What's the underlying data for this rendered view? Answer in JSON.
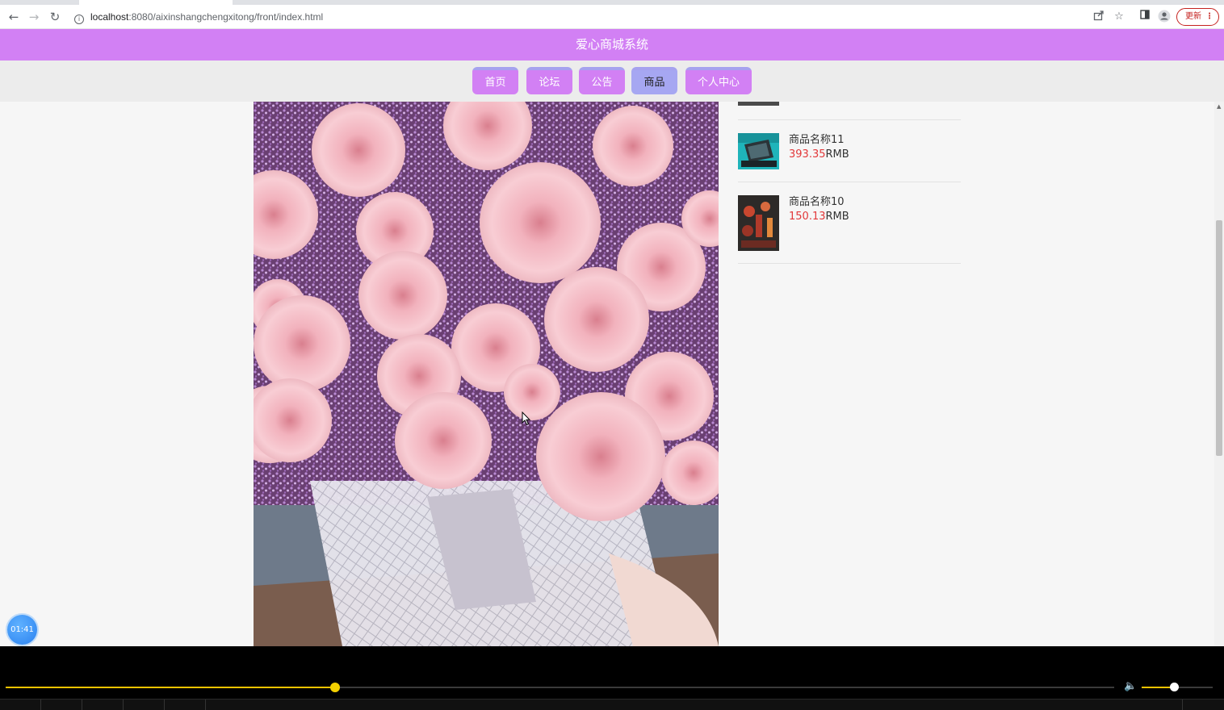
{
  "browser": {
    "url_host": "localhost",
    "url_path": ":8080/aixinshangchengxitong/front/index.html",
    "update_label": "更新",
    "info_glyph": "i",
    "icons": [
      "back-icon",
      "forward-icon",
      "reload-icon",
      "site-info-icon",
      "share-icon",
      "star-icon",
      "side-panel-icon",
      "profile-icon",
      "more-icon"
    ]
  },
  "site": {
    "title": "爱心商城系统",
    "nav": [
      {
        "label": "首页",
        "active": false
      },
      {
        "label": "论坛",
        "active": false
      },
      {
        "label": "公告",
        "active": false
      },
      {
        "label": "商品",
        "active": true
      },
      {
        "label": "个人中心",
        "active": false
      }
    ]
  },
  "recommend": [
    {
      "name": "商品名称11",
      "price": "393.35",
      "unit": "RMB",
      "thumb": "teal-laptop-thumbnail"
    },
    {
      "name": "商品名称10",
      "price": "150.13",
      "unit": "RMB",
      "thumb": "cosmetics-thumbnail"
    }
  ],
  "main_image": {
    "subject": "pink-rose-bouquet"
  },
  "overlay": {
    "timer": "01:41"
  },
  "player": {
    "progress": 0.297,
    "volume": 0.45
  },
  "colors": {
    "brand": "#d280f4",
    "nav_active": "#a6a7f2",
    "price": "#e2383a",
    "seek": "#f3c300"
  }
}
